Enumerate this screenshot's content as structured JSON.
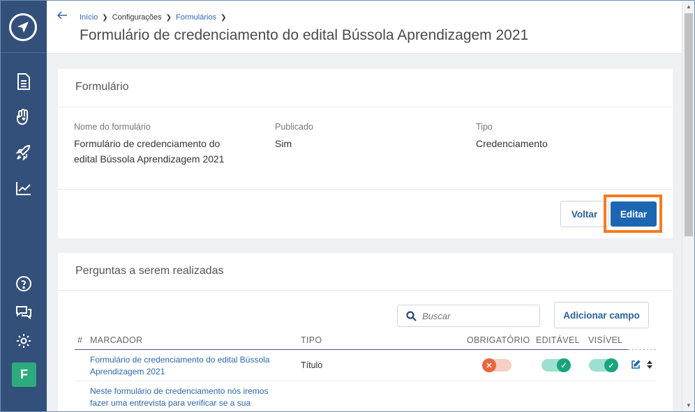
{
  "sidebar": {
    "logo": "compass-logo",
    "items": [
      {
        "name": "document-icon"
      },
      {
        "name": "hand-heart-icon"
      },
      {
        "name": "rocket-icon"
      },
      {
        "name": "chart-icon"
      }
    ],
    "bottom": [
      {
        "name": "help-icon"
      },
      {
        "name": "chat-icon"
      },
      {
        "name": "settings-icon"
      }
    ],
    "avatar_letter": "F"
  },
  "header": {
    "breadcrumb": [
      "Início",
      "Configurações",
      "Formulários"
    ],
    "title": "Formulário de credenciamento do edital Bússola Aprendizagem 2021"
  },
  "form_card": {
    "title": "Formulário",
    "fields": [
      {
        "label": "Nome do formulário",
        "value_line1": "Formulário de credenciamento do",
        "value_line2": "edital Bússola Aprendizagem 2021"
      },
      {
        "label": "Publicado",
        "value": "Sim"
      },
      {
        "label": "Tipo",
        "value": "Credenciamento"
      }
    ],
    "back_label": "Voltar",
    "edit_label": "Editar"
  },
  "questions_card": {
    "title": "Perguntas a serem realizadas",
    "search_placeholder": "Buscar",
    "add_label": "Adicionar campo",
    "columns": [
      "#",
      "MARCADOR",
      "TIPO",
      "OBRIGATÓRIO",
      "EDITÁVEL",
      "VISÍVEL"
    ],
    "rows": [
      {
        "marker_line1": "Formulário de credenciamento do edital Bússola",
        "marker_line2": "Aprendizagem 2021",
        "type": "Título",
        "required": false,
        "editable": true,
        "visible": true
      },
      {
        "marker_line1": "Neste formulário de credenciamento nós iremos",
        "marker_line2": "fazer uma entrevista para verificar se a sua"
      }
    ]
  },
  "colors": {
    "sidebar": "#33507a",
    "primary": "#1d66b3",
    "highlight": "#f47b20",
    "toggle_on": "#19a57d",
    "toggle_off": "#e8663f",
    "avatar": "#2dab7f"
  }
}
